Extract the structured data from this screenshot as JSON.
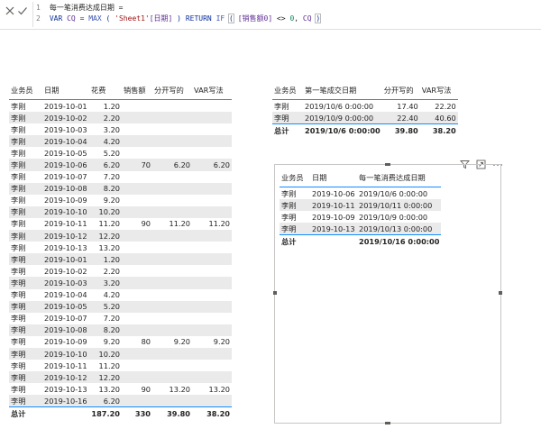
{
  "formula": {
    "line1_num": "1",
    "line2_num": "2",
    "measure_name": "每一笔消费达成日期 =",
    "var_kw": "VAR",
    "var_name": "CQ",
    "eq": "=",
    "max_fn": "MAX",
    "table_ref": "'Sheet1'",
    "col_ref": "[日期]",
    "return_kw": "RETURN",
    "if_kw": "IF",
    "measure_ref": "[销售额0]",
    "op": "<>",
    "zero": "0",
    "cq": "CQ"
  },
  "table_left": {
    "headers": [
      "业务员",
      "日期",
      "花费",
      "销售额",
      "分开写的",
      "VAR写法"
    ],
    "rows": [
      [
        "李刚",
        "2019-10-01",
        "1.20",
        "",
        "",
        ""
      ],
      [
        "李刚",
        "2019-10-02",
        "2.20",
        "",
        "",
        ""
      ],
      [
        "李刚",
        "2019-10-03",
        "3.20",
        "",
        "",
        ""
      ],
      [
        "李刚",
        "2019-10-04",
        "4.20",
        "",
        "",
        ""
      ],
      [
        "李刚",
        "2019-10-05",
        "5.20",
        "",
        "",
        ""
      ],
      [
        "李刚",
        "2019-10-06",
        "6.20",
        "70",
        "6.20",
        "6.20"
      ],
      [
        "李刚",
        "2019-10-07",
        "7.20",
        "",
        "",
        ""
      ],
      [
        "李刚",
        "2019-10-08",
        "8.20",
        "",
        "",
        ""
      ],
      [
        "李刚",
        "2019-10-09",
        "9.20",
        "",
        "",
        ""
      ],
      [
        "李刚",
        "2019-10-10",
        "10.20",
        "",
        "",
        ""
      ],
      [
        "李刚",
        "2019-10-11",
        "11.20",
        "90",
        "11.20",
        "11.20"
      ],
      [
        "李刚",
        "2019-10-12",
        "12.20",
        "",
        "",
        ""
      ],
      [
        "李刚",
        "2019-10-13",
        "13.20",
        "",
        "",
        ""
      ],
      [
        "李明",
        "2019-10-01",
        "1.20",
        "",
        "",
        ""
      ],
      [
        "李明",
        "2019-10-02",
        "2.20",
        "",
        "",
        ""
      ],
      [
        "李明",
        "2019-10-03",
        "3.20",
        "",
        "",
        ""
      ],
      [
        "李明",
        "2019-10-04",
        "4.20",
        "",
        "",
        ""
      ],
      [
        "李明",
        "2019-10-05",
        "5.20",
        "",
        "",
        ""
      ],
      [
        "李明",
        "2019-10-07",
        "7.20",
        "",
        "",
        ""
      ],
      [
        "李明",
        "2019-10-08",
        "8.20",
        "",
        "",
        ""
      ],
      [
        "李明",
        "2019-10-09",
        "9.20",
        "80",
        "9.20",
        "9.20"
      ],
      [
        "李明",
        "2019-10-10",
        "10.20",
        "",
        "",
        ""
      ],
      [
        "李明",
        "2019-10-11",
        "11.20",
        "",
        "",
        ""
      ],
      [
        "李明",
        "2019-10-12",
        "12.20",
        "",
        "",
        ""
      ],
      [
        "李明",
        "2019-10-13",
        "13.20",
        "90",
        "13.20",
        "13.20"
      ],
      [
        "李明",
        "2019-10-16",
        "6.20",
        "",
        "",
        ""
      ]
    ],
    "total": [
      "总计",
      "",
      "187.20",
      "330",
      "39.80",
      "38.20"
    ]
  },
  "table_right_top": {
    "headers": [
      "业务员",
      "第一笔成交日期",
      "分开写的",
      "VAR写法"
    ],
    "rows": [
      [
        "李刚",
        "2019/10/6 0:00:00",
        "17.40",
        "22.20"
      ],
      [
        "李明",
        "2019/10/9 0:00:00",
        "22.40",
        "40.60"
      ]
    ],
    "total": [
      "总计",
      "2019/10/6 0:00:00",
      "39.80",
      "38.20"
    ]
  },
  "table_right_bottom": {
    "headers": [
      "业务员",
      "日期",
      "每一笔消费达成日期"
    ],
    "rows": [
      [
        "李刚",
        "2019-10-06",
        "2019/10/6 0:00:00"
      ],
      [
        "李刚",
        "2019-10-11",
        "2019/10/11 0:00:00"
      ],
      [
        "李明",
        "2019-10-09",
        "2019/10/9 0:00:00"
      ],
      [
        "李明",
        "2019-10-13",
        "2019/10/13 0:00:00"
      ]
    ],
    "total": [
      "总计",
      "",
      "2019/10/16 0:00:00"
    ]
  },
  "icons": {
    "cancel": "close-icon",
    "commit": "check-icon",
    "filter": "filter-icon",
    "focus": "focus-mode-icon",
    "more": "more-options-icon"
  },
  "colors": {
    "accent": "#118dff",
    "stripe": "#eaeaea"
  }
}
